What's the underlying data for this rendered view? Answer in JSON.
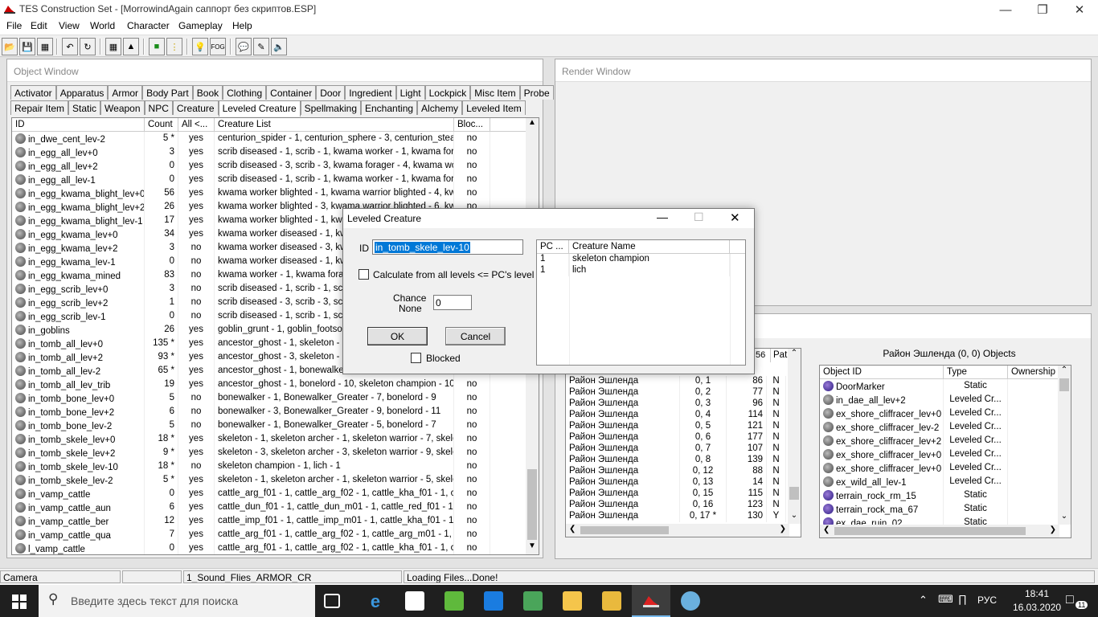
{
  "window": {
    "title": "TES Construction Set - [MorrowindAgain саппорт без скриптов.ESP]"
  },
  "menu": [
    "File",
    "Edit",
    "View",
    "World",
    "Character",
    "Gameplay",
    "Help"
  ],
  "toolbar": {
    "fog_label": "FOG"
  },
  "object_window": {
    "title": "Object Window",
    "tabs_row1": [
      "Activator",
      "Apparatus",
      "Armor",
      "Body Part",
      "Book",
      "Clothing",
      "Container",
      "Door",
      "Ingredient",
      "Light",
      "Lockpick",
      "Misc Item",
      "Probe"
    ],
    "tabs_row2": [
      "Repair Item",
      "Static",
      "Weapon",
      "NPC",
      "Creature",
      "Leveled Creature",
      "Spellmaking",
      "Enchanting",
      "Alchemy",
      "Leveled Item"
    ],
    "active_tab": "Leveled Creature",
    "columns": [
      "ID",
      "Count",
      "All <...",
      "Creature List",
      "Bloc..."
    ],
    "rows": [
      [
        "in_dwe_cent_lev-2",
        "5 *",
        "yes",
        "centurion_spider - 1, centurion_sphere - 3, centurion_stea...",
        "no"
      ],
      [
        "in_egg_all_lev+0",
        "3",
        "yes",
        "scrib diseased - 1, scrib - 1, kwama worker - 1, kwama fora...",
        "no"
      ],
      [
        "in_egg_all_lev+2",
        "0",
        "yes",
        "scrib diseased - 3, scrib - 3, kwama forager - 4, kwama wor...",
        "no"
      ],
      [
        "in_egg_all_lev-1",
        "0",
        "yes",
        "scrib diseased - 1, scrib - 1, kwama worker - 1, kwama fora...",
        "no"
      ],
      [
        "in_egg_kwama_blight_lev+0",
        "56",
        "yes",
        "kwama worker blighted - 1, kwama warrior blighted - 4, kwa...",
        "no"
      ],
      [
        "in_egg_kwama_blight_lev+2",
        "26",
        "yes",
        "kwama worker blighted - 3, kwama warrior blighted - 6, kwa...",
        "no"
      ],
      [
        "in_egg_kwama_blight_lev-1",
        "17",
        "yes",
        "kwama worker blighted - 1, kwan",
        "no"
      ],
      [
        "in_egg_kwama_lev+0",
        "34",
        "yes",
        "kwama worker diseased - 1, kwa",
        "no"
      ],
      [
        "in_egg_kwama_lev+2",
        "3",
        "no",
        "kwama worker diseased - 3, kwa",
        "no"
      ],
      [
        "in_egg_kwama_lev-1",
        "0",
        "no",
        "kwama worker diseased - 1, kwa",
        "no"
      ],
      [
        "in_egg_kwama_mined",
        "83",
        "no",
        "kwama worker - 1, kwama forage",
        "no"
      ],
      [
        "in_egg_scrib_lev+0",
        "3",
        "no",
        "scrib diseased - 1, scrib - 1, scrib",
        "no"
      ],
      [
        "in_egg_scrib_lev+2",
        "1",
        "no",
        "scrib diseased - 3, scrib - 3, scrib",
        "no"
      ],
      [
        "in_egg_scrib_lev-1",
        "0",
        "no",
        "scrib diseased - 1, scrib - 1, scrib",
        "no"
      ],
      [
        "in_goblins",
        "26",
        "yes",
        "goblin_grunt - 1, goblin_footsoldie",
        "no"
      ],
      [
        "in_tomb_all_lev+0",
        "135 *",
        "yes",
        "ancestor_ghost - 1, skeleton - 3,",
        "no"
      ],
      [
        "in_tomb_all_lev+2",
        "93 *",
        "yes",
        "ancestor_ghost - 3, skeleton - 5,",
        "no"
      ],
      [
        "in_tomb_all_lev-2",
        "65 *",
        "yes",
        "ancestor_ghost - 1, bonewalker -",
        "no"
      ],
      [
        "in_tomb_all_lev_trib",
        "19",
        "yes",
        "ancestor_ghost - 1, bonelord - 10, skeleton champion - 10, ...",
        "no"
      ],
      [
        "in_tomb_bone_lev+0",
        "5",
        "no",
        "bonewalker - 1, Bonewalker_Greater - 7, bonelord - 9",
        "no"
      ],
      [
        "in_tomb_bone_lev+2",
        "6",
        "no",
        "bonewalker - 3, Bonewalker_Greater - 9, bonelord - 11",
        "no"
      ],
      [
        "in_tomb_bone_lev-2",
        "5",
        "no",
        "bonewalker - 1, Bonewalker_Greater - 5, bonelord - 7",
        "no"
      ],
      [
        "in_tomb_skele_lev+0",
        "18 *",
        "yes",
        "skeleton - 1, skeleton archer - 1, skeleton warrior - 7, skelet...",
        "no"
      ],
      [
        "in_tomb_skele_lev+2",
        "9 *",
        "yes",
        "skeleton - 3, skeleton archer - 3, skeleton warrior - 9, skelet...",
        "no"
      ],
      [
        "in_tomb_skele_lev-10",
        "18 *",
        "no",
        "skeleton champion - 1, lich - 1",
        "no"
      ],
      [
        "in_tomb_skele_lev-2",
        "5 *",
        "yes",
        "skeleton - 1, skeleton archer - 1, skeleton warrior - 5, skelet...",
        "no"
      ],
      [
        "in_vamp_cattle",
        "0",
        "yes",
        "cattle_arg_f01 - 1, cattle_arg_f02 - 1, cattle_kha_f01 - 1, c...",
        "no"
      ],
      [
        "in_vamp_cattle_aun",
        "6",
        "yes",
        "cattle_dun_f01 - 1, cattle_dun_m01 - 1, cattle_red_f01 - 1, ...",
        "no"
      ],
      [
        "in_vamp_cattle_ber",
        "12",
        "yes",
        "cattle_imp_f01 - 1, cattle_imp_m01 - 1, cattle_kha_f01 - 1, ...",
        "no"
      ],
      [
        "in_vamp_cattle_qua",
        "7",
        "yes",
        "cattle_arg_f01 - 1, cattle_arg_f02 - 1, cattle_arg_m01 - 1, c...",
        "no"
      ],
      [
        "l_vamp_cattle",
        "0",
        "yes",
        "cattle_arg_f01 - 1, cattle_arg_f02 - 1, cattle_kha_f01 - 1, c...",
        "no"
      ]
    ]
  },
  "render_window": {
    "title": "Render Window"
  },
  "cell_view": {
    "col_headers": [
      "Pat"
    ],
    "header_cut": "56",
    "rows": [
      [
        "Район Эшленда",
        "0, 1",
        "86",
        "N"
      ],
      [
        "Район Эшленда",
        "0, 2",
        "77",
        "N"
      ],
      [
        "Район Эшленда",
        "0, 3",
        "96",
        "N"
      ],
      [
        "Район Эшленда",
        "0, 4",
        "114",
        "N"
      ],
      [
        "Район Эшленда",
        "0, 5",
        "121",
        "N"
      ],
      [
        "Район Эшленда",
        "0, 6",
        "177",
        "N"
      ],
      [
        "Район Эшленда",
        "0, 7",
        "107",
        "N"
      ],
      [
        "Район Эшленда",
        "0, 8",
        "139",
        "N"
      ],
      [
        "Район Эшленда",
        "0, 12",
        "88",
        "N"
      ],
      [
        "Район Эшленда",
        "0, 13",
        "14",
        "N"
      ],
      [
        "Район Эшленда",
        "0, 15",
        "115",
        "N"
      ],
      [
        "Район Эшленда",
        "0, 16",
        "123",
        "N"
      ],
      [
        "Район Эшленда",
        "0, 17 *",
        "130",
        "Y"
      ]
    ],
    "objects_title": "Район Эшленда (0, 0) Objects",
    "obj_columns": [
      "Object ID",
      "Type",
      "Ownership"
    ],
    "objects": [
      [
        "DoorMarker",
        "Static"
      ],
      [
        "in_dae_all_lev+2",
        "Leveled Cr..."
      ],
      [
        "ex_shore_cliffracer_lev+0",
        "Leveled Cr..."
      ],
      [
        "ex_shore_cliffracer_lev-2",
        "Leveled Cr..."
      ],
      [
        "ex_shore_cliffracer_lev+2",
        "Leveled Cr..."
      ],
      [
        "ex_shore_cliffracer_lev+0",
        "Leveled Cr..."
      ],
      [
        "ex_shore_cliffracer_lev+0",
        "Leveled Cr..."
      ],
      [
        "ex_wild_all_lev-1",
        "Leveled Cr..."
      ],
      [
        "terrain_rock_rm_15",
        "Static"
      ],
      [
        "terrain_rock_ma_67",
        "Static"
      ],
      [
        "ex_dae_ruin_02",
        "Static"
      ]
    ]
  },
  "dialog": {
    "title": "Leveled Creature",
    "id_label": "ID",
    "id_value": "in_tomb_skele_lev-10",
    "calc_label": "Calculate from all levels <= PC's level",
    "chance_label1": "Chance",
    "chance_label2": "None",
    "chance_value": "0",
    "ok": "OK",
    "cancel": "Cancel",
    "blocked": "Blocked",
    "list_columns": [
      "PC ...",
      "Creature Name"
    ],
    "list_rows": [
      [
        "1",
        "skeleton champion"
      ],
      [
        "1",
        "lich"
      ]
    ]
  },
  "statusbar": {
    "p1": "Camera",
    "p2": "",
    "p3": "1_Sound_Flies_ARMOR_CR",
    "p4": "Loading Files...Done!"
  },
  "taskbar": {
    "search_placeholder": "Введите здесь текст для поиска",
    "lang": "РУС",
    "time": "18:41",
    "date": "16.03.2020",
    "notif": "11"
  }
}
